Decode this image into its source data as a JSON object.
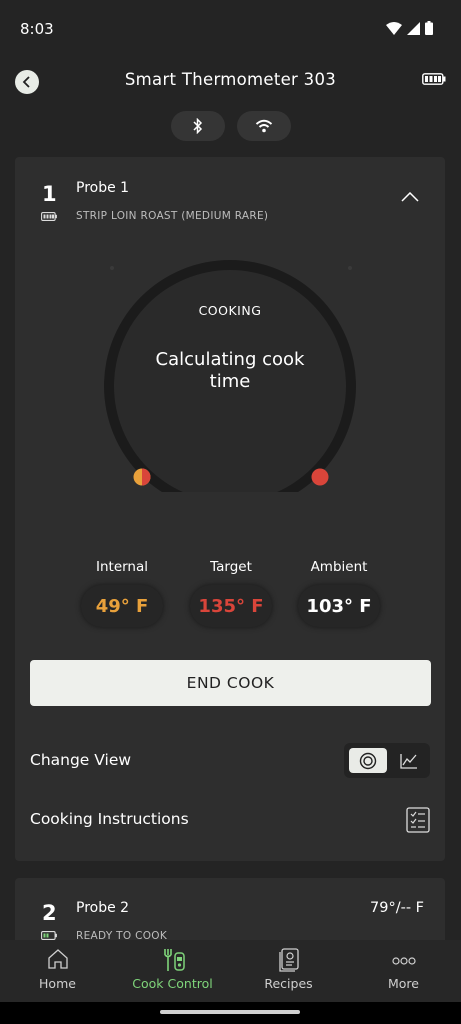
{
  "status": {
    "time": "8:03"
  },
  "header": {
    "title": "Smart Thermometer 303"
  },
  "probe1": {
    "number": "1",
    "name": "Probe 1",
    "subtitle": "STRIP LOIN ROAST (MEDIUM RARE)",
    "state": "COOKING",
    "message": "Calculating cook time",
    "internal_label": "Internal",
    "internal_value": "49° F",
    "target_label": "Target",
    "target_value": "135° F",
    "ambient_label": "Ambient",
    "ambient_value": "103° F",
    "end_cook": "END COOK",
    "change_view": "Change View",
    "cooking_instructions": "Cooking Instructions"
  },
  "probe2": {
    "number": "2",
    "name": "Probe 2",
    "subtitle": "READY TO COOK",
    "temp": "79°/-- F"
  },
  "nav": [
    {
      "label": "Home",
      "icon": "home-icon"
    },
    {
      "label": "Cook Control",
      "icon": "cook-control-icon"
    },
    {
      "label": "Recipes",
      "icon": "recipes-icon"
    },
    {
      "label": "More",
      "icon": "more-icon"
    }
  ],
  "colors": {
    "internal": "#e9a13b",
    "target": "#d9453a",
    "active_nav": "#7fd47a"
  }
}
